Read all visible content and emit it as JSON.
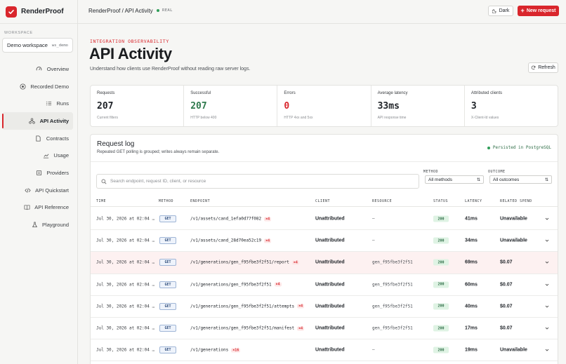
{
  "brand": {
    "name": "RenderProof"
  },
  "workspace": {
    "label": "WORKSPACE",
    "name": "Demo workspace",
    "id": "ws_demo"
  },
  "nav": [
    {
      "label": "Overview",
      "icon": "gauge-icon"
    },
    {
      "label": "Recorded Demo",
      "icon": "record-icon"
    },
    {
      "label": "Runs",
      "icon": "list-icon"
    },
    {
      "label": "API Activity",
      "icon": "activity-icon",
      "active": true
    },
    {
      "label": "Contracts",
      "icon": "document-icon"
    },
    {
      "label": "Usage",
      "icon": "chart-icon"
    },
    {
      "label": "Providers",
      "icon": "box-icon"
    },
    {
      "label": "API Quickstart",
      "icon": "code-icon"
    },
    {
      "label": "API Reference",
      "icon": "book-icon"
    },
    {
      "label": "Playground",
      "icon": "flask-icon"
    }
  ],
  "topbar": {
    "breadcrumb": "RenderProof / API Activity",
    "env": "REAL",
    "dark_label": "Dark",
    "new_label": "New request"
  },
  "header": {
    "eyebrow": "INTEGRATION OBSERVABILITY",
    "title": "API Activity",
    "subtitle": "Understand how clients use RenderProof without reading raw server logs.",
    "refresh_label": "Refresh"
  },
  "stats": [
    {
      "label": "Requests",
      "value": "207",
      "note": "Current filters",
      "color": "#1f2328"
    },
    {
      "label": "Successful",
      "value": "207",
      "note": "HTTP below 400",
      "color": "#2f7a4d"
    },
    {
      "label": "Errors",
      "value": "0",
      "note": "HTTP 4xx and 5xx",
      "color": "#d9262c"
    },
    {
      "label": "Average latency",
      "value": "33ms",
      "note": "API response time",
      "color": "#1f2328"
    },
    {
      "label": "Attributed clients",
      "value": "3",
      "note": "X-Client-Id values",
      "color": "#1f2328"
    }
  ],
  "log": {
    "title": "Request log",
    "subtitle": "Repeated GET polling is grouped; writes always remain separate.",
    "persist": "Persisted in PostgreSQL",
    "search_placeholder": "Search endpoint, request ID, client, or resource",
    "method_label": "METHOD",
    "method_value": "All methods",
    "outcome_label": "OUTCOME",
    "outcome_value": "All outcomes",
    "columns": {
      "time": "TIME",
      "method": "METHOD",
      "endpoint": "ENDPOINT",
      "client": "CLIENT",
      "resource": "RESOURCE",
      "status": "STATUS",
      "latency": "LATENCY",
      "spend": "RELATED SPEND"
    },
    "rows": [
      {
        "time": "Jul 30, 2026 at 02:04 …",
        "method": "GET",
        "endpoint": "/v1/assets/cand_1efa0d77f082",
        "count": "×4",
        "client": "Unattributed",
        "resource": "—",
        "status": "200",
        "latency": "41ms",
        "spend": "Unavailable"
      },
      {
        "time": "Jul 30, 2026 at 02:04 …",
        "method": "GET",
        "endpoint": "/v1/assets/cand_28d70ea52c19",
        "count": "×4",
        "client": "Unattributed",
        "resource": "—",
        "status": "200",
        "latency": "34ms",
        "spend": "Unavailable"
      },
      {
        "time": "Jul 30, 2026 at 02:04 …",
        "method": "GET",
        "endpoint": "/v1/generations/gen_f95fbe3f2f51/report",
        "count": "×4",
        "client": "Unattributed",
        "resource": "gen_f95fbe3f2f51",
        "status": "200",
        "latency": "69ms",
        "spend": "$0.07",
        "highlight": true
      },
      {
        "time": "Jul 30, 2026 at 02:04 …",
        "method": "GET",
        "endpoint": "/v1/generations/gen_f95fbe3f2f51",
        "count": "×4",
        "client": "Unattributed",
        "resource": "gen_f95fbe3f2f51",
        "status": "200",
        "latency": "60ms",
        "spend": "$0.07"
      },
      {
        "time": "Jul 30, 2026 at 02:04 …",
        "method": "GET",
        "endpoint": "/v1/generations/gen_f95fbe3f2f51/attempts",
        "count": "×4",
        "client": "Unattributed",
        "resource": "gen_f95fbe3f2f51",
        "status": "200",
        "latency": "40ms",
        "spend": "$0.07"
      },
      {
        "time": "Jul 30, 2026 at 02:04 …",
        "method": "GET",
        "endpoint": "/v1/generations/gen_f95fbe3f2f51/manifest",
        "count": "×4",
        "client": "Unattributed",
        "resource": "gen_f95fbe3f2f51",
        "status": "200",
        "latency": "17ms",
        "spend": "$0.07"
      },
      {
        "time": "Jul 30, 2026 at 02:04 …",
        "method": "GET",
        "endpoint": "/v1/generations",
        "count": "×16",
        "client": "Unattributed",
        "resource": "—",
        "status": "200",
        "latency": "19ms",
        "spend": "Unavailable"
      }
    ]
  }
}
